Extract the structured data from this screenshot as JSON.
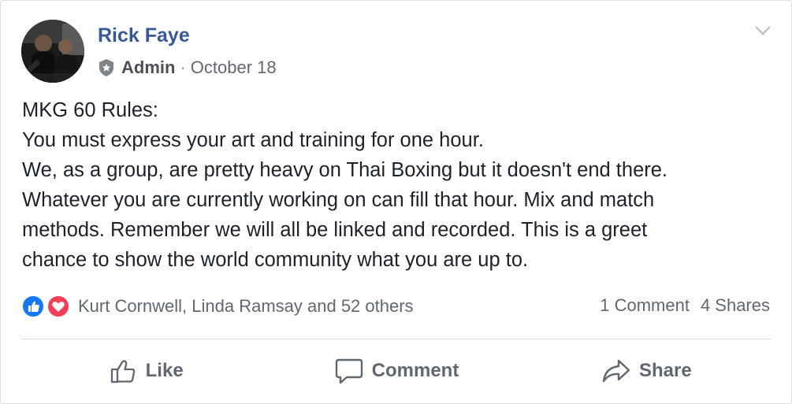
{
  "post": {
    "author": "Rick Faye",
    "role": "Admin",
    "separator": "·",
    "date": "October 18",
    "lines": [
      "MKG 60 Rules:",
      "You must express your art and training for one hour.",
      "We, as a group, are pretty heavy on Thai Boxing but it doesn't end there.",
      "Whatever you are currently working on can fill that hour. Mix and match",
      "methods. Remember we will all be linked and recorded. This is a greet",
      "chance to show the world community what you are up to."
    ]
  },
  "reactions": {
    "names": "Kurt Cornwell, Linda Ramsay and 52 others",
    "icons": [
      "like-icon",
      "love-icon"
    ],
    "like_color": "#1877f2",
    "love_color": "#f33e58"
  },
  "counts": {
    "comments": "1 Comment",
    "shares": "4 Shares"
  },
  "actions": {
    "like": "Like",
    "comment": "Comment",
    "share": "Share"
  },
  "colors": {
    "author": "#385898",
    "text": "#1d2129",
    "muted": "#606770"
  }
}
